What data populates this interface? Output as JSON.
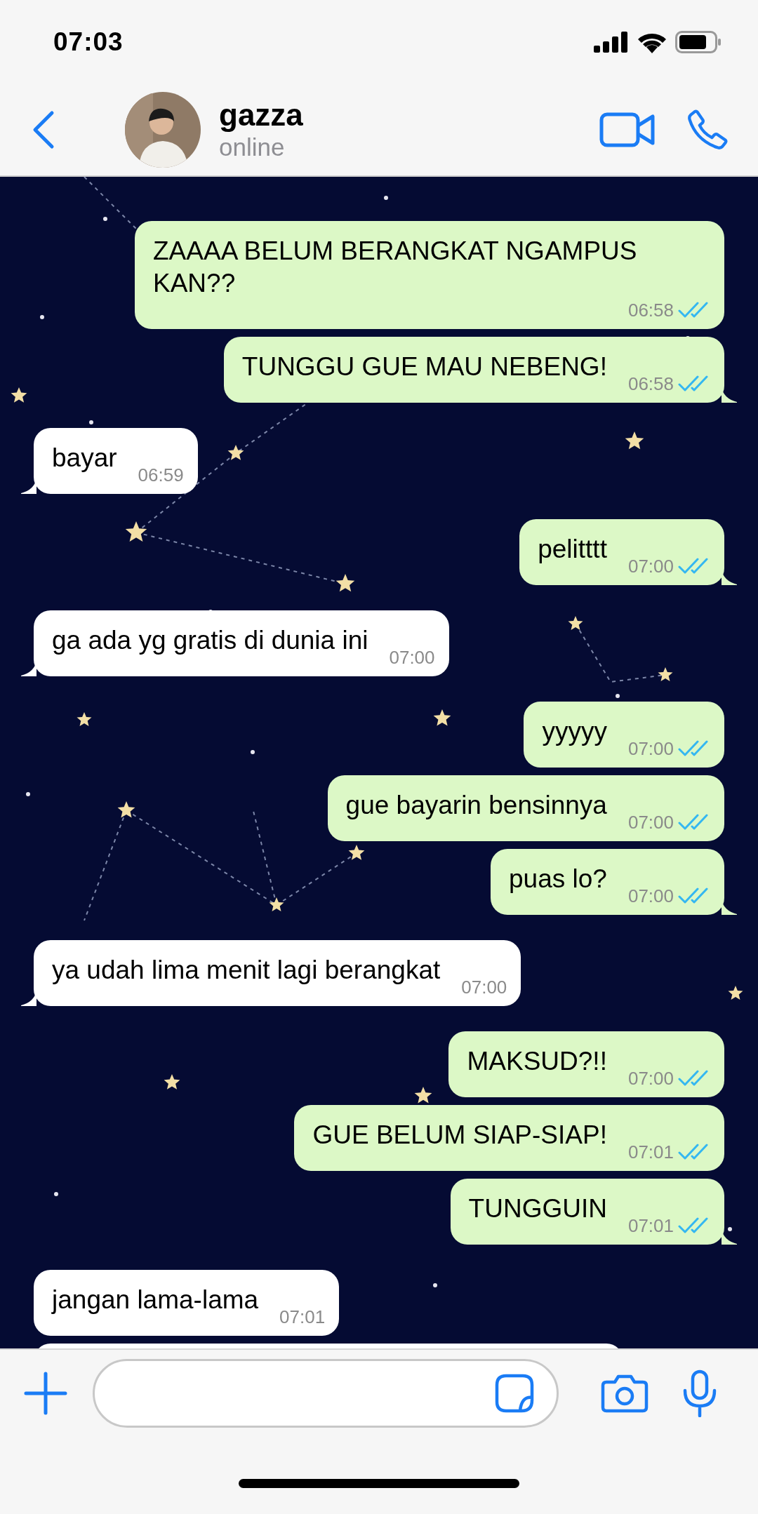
{
  "status_bar": {
    "time": "07:03"
  },
  "contact": {
    "name": "gazza",
    "status": "online"
  },
  "messages": [
    {
      "kind": "outgoing",
      "text": "ZAAAA BELUM BERANGKAT NGAMPUS KAN??",
      "time": "06:58",
      "read": true,
      "tail": false
    },
    {
      "kind": "outgoing",
      "text": "TUNGGU GUE MAU NEBENG!",
      "time": "06:58",
      "read": true,
      "tail": true
    },
    {
      "kind": "incoming",
      "text": "bayar",
      "time": "06:59",
      "tail": true
    },
    {
      "kind": "outgoing",
      "text": "pelitttt",
      "time": "07:00",
      "read": true,
      "tail": true
    },
    {
      "kind": "incoming",
      "text": "ga ada yg gratis di dunia ini",
      "time": "07:00",
      "tail": true
    },
    {
      "kind": "outgoing",
      "text": "yyyyy",
      "time": "07:00",
      "read": true,
      "tail": false
    },
    {
      "kind": "outgoing",
      "text": "gue bayarin bensinnya",
      "time": "07:00",
      "read": true,
      "tail": false
    },
    {
      "kind": "outgoing",
      "text": "puas lo?",
      "time": "07:00",
      "read": true,
      "tail": true
    },
    {
      "kind": "incoming",
      "text": "ya udah lima menit lagi berangkat",
      "time": "07:00",
      "tail": true
    },
    {
      "kind": "outgoing",
      "text": "MAKSUD?!!",
      "time": "07:00",
      "read": true,
      "tail": false
    },
    {
      "kind": "outgoing",
      "text": "GUE BELUM SIAP-SIAP!",
      "time": "07:01",
      "read": true,
      "tail": false
    },
    {
      "kind": "outgoing",
      "text": "TUNGGUIN",
      "time": "07:01",
      "read": true,
      "tail": true
    },
    {
      "kind": "incoming",
      "text": "jangan lama-lama",
      "time": "07:01",
      "tail": false
    },
    {
      "kind": "incoming"
    }
  ]
}
